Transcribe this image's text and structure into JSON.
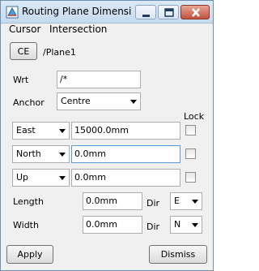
{
  "window": {
    "title": "Routing Plane Dimensi..."
  },
  "menu": {
    "items": [
      "Cursor",
      "Intersection"
    ]
  },
  "ce": {
    "button": "CE",
    "path": "/Plane1"
  },
  "wrt": {
    "label": "Wrt",
    "value": "/*"
  },
  "anchor": {
    "label": "Anchor",
    "value": "Centre"
  },
  "lock_label": "Lock",
  "rows": [
    {
      "axis": "East",
      "value": "15000.0mm",
      "locked": false
    },
    {
      "axis": "North",
      "value": "0.0mm",
      "locked": false
    },
    {
      "axis": "Up",
      "value": "0.0mm",
      "locked": false
    }
  ],
  "length": {
    "label": "Length",
    "value": "0.0mm",
    "dir_label": "Dir",
    "dir": "E"
  },
  "width": {
    "label": "Width",
    "value": "0.0mm",
    "dir_label": "Dir",
    "dir": "N"
  },
  "buttons": {
    "apply": "Apply",
    "dismiss": "Dismiss"
  },
  "colors": {
    "titlebar": "#c6daef",
    "close": "#c2513b",
    "dialog_bg": "#f0f0f0",
    "focus": "#5a9bd5"
  }
}
